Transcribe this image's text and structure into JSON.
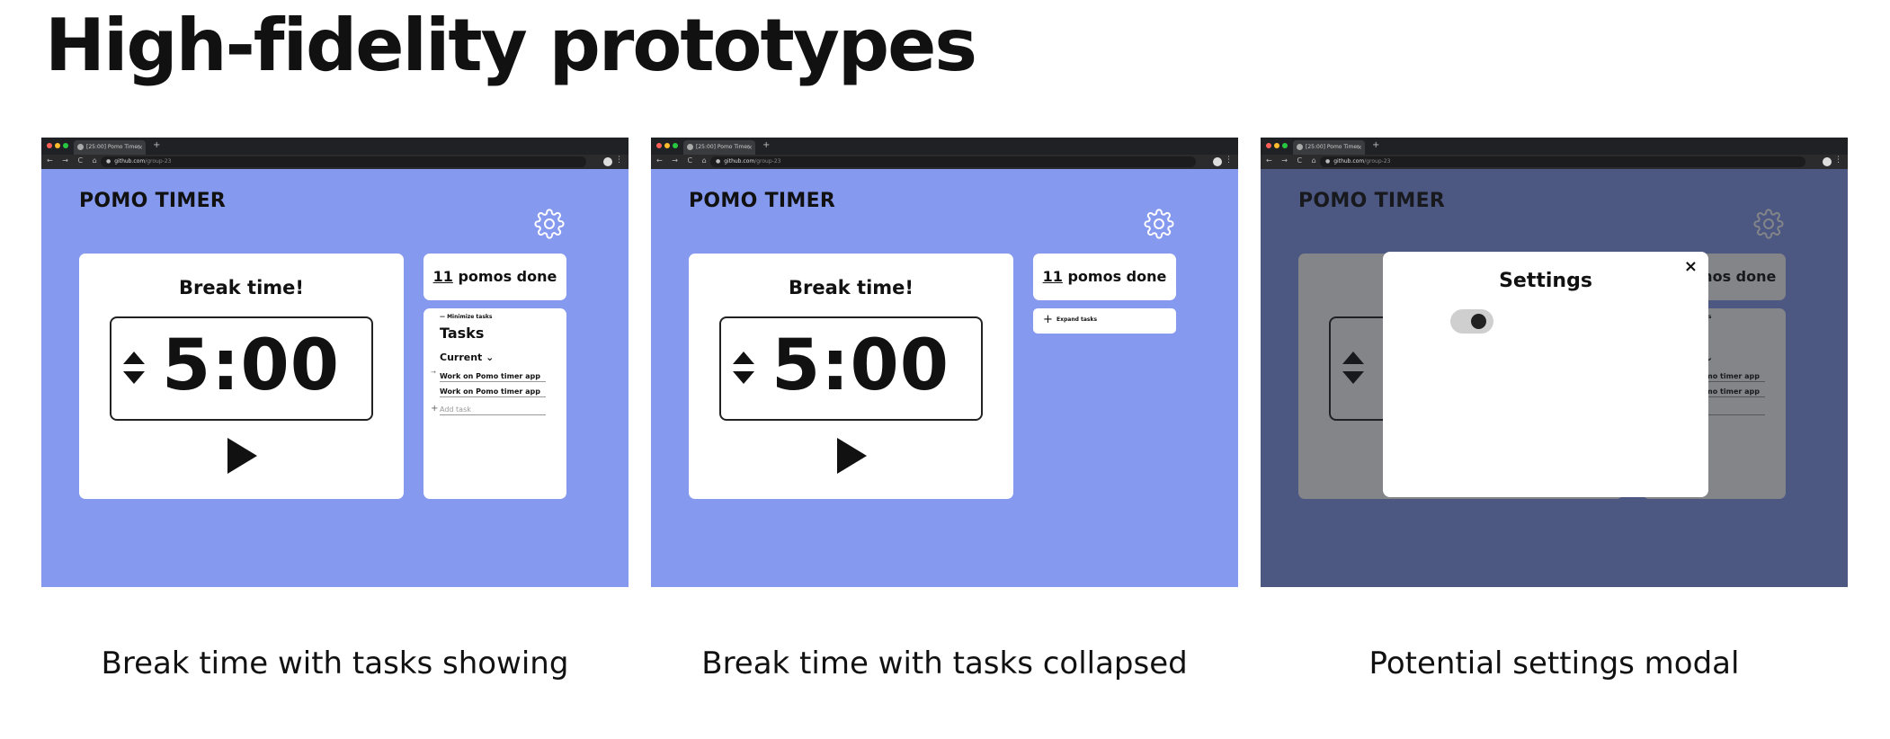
{
  "page": {
    "title": "High-fidelity prototypes"
  },
  "browser": {
    "tab_title": "[25:00] Pomo Timer",
    "tab_close": "×",
    "new_tab": "+",
    "nav_icons": "← → C ⌂",
    "url_host": "github.com",
    "url_path": "/group-23",
    "menu": "⋮"
  },
  "app": {
    "title": "POMO TIMER",
    "break_label": "Break time!",
    "time": "5:00",
    "pomos_count": "11",
    "pomos_text": " pomos done",
    "minimize_label": "— Minimize tasks",
    "tasks_heading": "Tasks",
    "current_label": "Current ⌄",
    "tasks": [
      "Work on Pomo timer app",
      "Work on Pomo timer app"
    ],
    "add_task_placeholder": "Add task",
    "add_plus": "+",
    "task_arrow": "→",
    "expand_plus": "+",
    "expand_label": "Expand tasks"
  },
  "modal": {
    "title": "Settings",
    "close": "×",
    "toggle_on": true
  },
  "captions": [
    "Break time with tasks showing",
    "Break time with tasks collapsed",
    "Potential settings modal"
  ],
  "colors": {
    "app_bg": "#8599ef",
    "card_bg": "#ffffff",
    "browser_chrome": "#2b2b2d"
  }
}
